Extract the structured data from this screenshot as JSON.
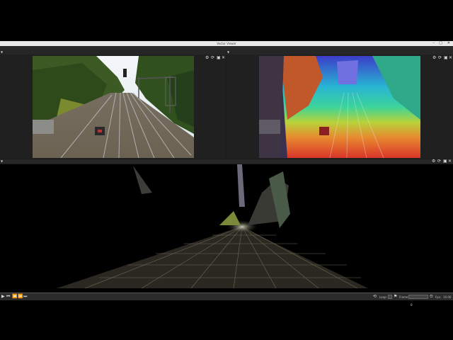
{
  "window": {
    "title": "Vector Viewer"
  },
  "menu": [
    "View",
    "Layouts",
    "Viewers",
    "Help"
  ],
  "panes": {
    "left": {
      "title": "Rectified Image"
    },
    "right": {
      "title": "Colorized Depth Map"
    },
    "bottom": {
      "title": "Point Cloud"
    }
  },
  "playbar": {
    "loop_label": "Loop:",
    "frame_label": "Frame:",
    "frame_value": "0",
    "fps_label": "Fps:",
    "fps_value": "10.00"
  },
  "icons": {
    "tool_icons": [
      "gear-icon",
      "refresh-icon",
      "save-icon",
      "close-icon"
    ],
    "play_icons": [
      "play-icon",
      "skip-start-icon",
      "step-back-icon",
      "step-forward-icon",
      "skip-end-icon"
    ]
  }
}
